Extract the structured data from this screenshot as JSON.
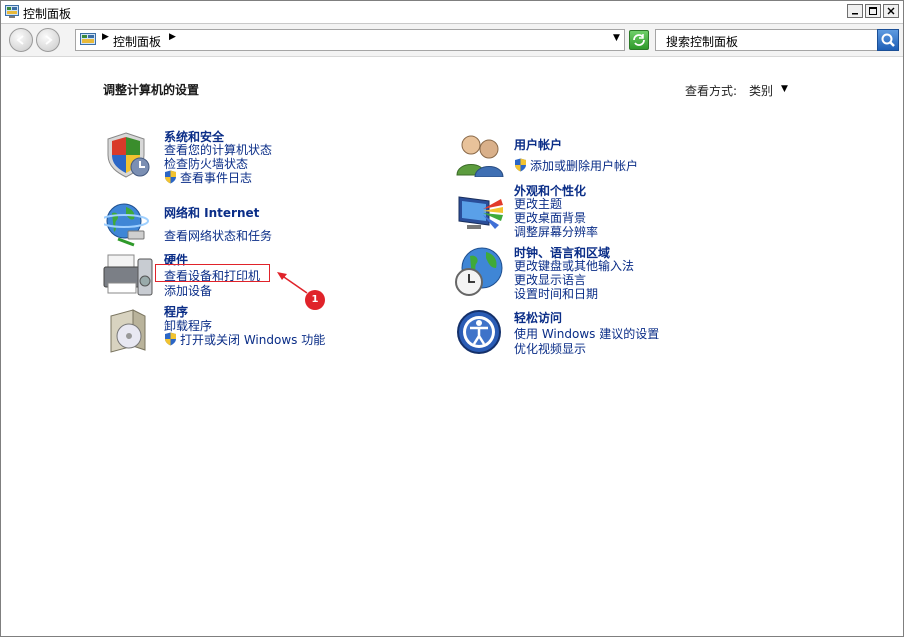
{
  "window": {
    "title": "控制面板",
    "buttons": [
      "minimize",
      "maximize",
      "close"
    ]
  },
  "navbar": {
    "address_text": "控制面板",
    "search_placeholder": "搜索控制面板"
  },
  "main": {
    "heading": "调整计算机的设置",
    "view_by_label": "查看方式:",
    "view_by_value": "类别"
  },
  "categories": {
    "system": {
      "title": "系统和安全",
      "links": [
        "查看您的计算机状态",
        "检查防火墙状态",
        "查看事件日志"
      ]
    },
    "network": {
      "title": "网络和 Internet",
      "links": [
        "查看网络状态和任务"
      ]
    },
    "hardware": {
      "title": "硬件",
      "links": [
        "查看设备和打印机",
        "添加设备"
      ]
    },
    "programs": {
      "title": "程序",
      "links": [
        "卸载程序",
        "打开或关闭 Windows 功能"
      ]
    },
    "users": {
      "title": "用户帐户",
      "links": [
        "添加或删除用户帐户"
      ]
    },
    "appearance": {
      "title": "外观和个性化",
      "links": [
        "更改主题",
        "更改桌面背景",
        "调整屏幕分辨率"
      ]
    },
    "clock": {
      "title": "时钟、语言和区域",
      "links": [
        "更改键盘或其他输入法",
        "更改显示语言",
        "设置时间和日期"
      ]
    },
    "ease": {
      "title": "轻松访问",
      "links": [
        "使用 Windows 建议的设置",
        "优化视频显示"
      ]
    }
  },
  "annotation": {
    "badge": "1",
    "color": "#e0232a"
  },
  "colors": {
    "link": "#0a2d87"
  }
}
